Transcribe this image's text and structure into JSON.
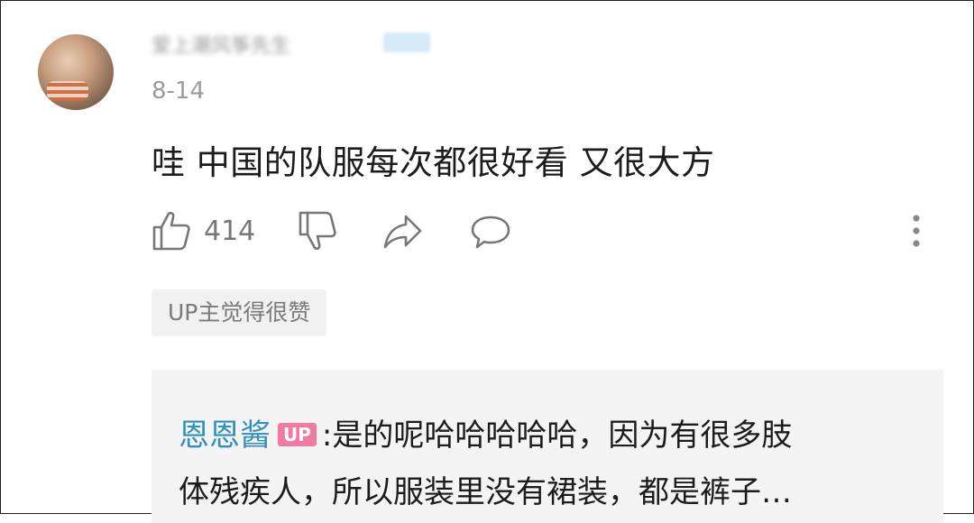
{
  "comment": {
    "username": "爱上潮风筝先生",
    "date": "8-14",
    "text": "哇 中国的队服每次都很好看 又很大方",
    "like_count": "414"
  },
  "actions": {
    "like_icon": "thumbs-up-icon",
    "dislike_icon": "thumbs-down-icon",
    "share_icon": "share-icon",
    "reply_icon": "reply-icon",
    "more_icon": "more-vertical-icon"
  },
  "up_liked_label": "UP主觉得很赞",
  "reply": {
    "author": "恩恩酱",
    "badge": "UP",
    "separator": ":",
    "line1": "是的呢哈哈哈哈哈，因为有很多肢",
    "line2": "体残疾人，所以服装里没有裙装，都是裤子…"
  },
  "colors": {
    "author": "#2f8fbd",
    "up_badge": "#f07aa2",
    "muted_text": "#9c9c9c",
    "reply_bg": "#f4f4f4"
  }
}
